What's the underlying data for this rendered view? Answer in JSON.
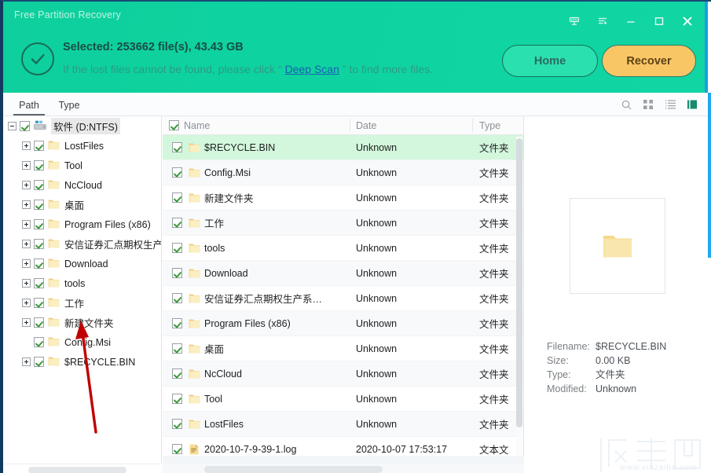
{
  "window": {
    "title": "Free Partition Recovery",
    "controls": [
      {
        "name": "cart-icon",
        "label": "Shop"
      },
      {
        "name": "feedback-icon",
        "label": "Feedback"
      },
      {
        "name": "minimize-icon",
        "label": "Minimize"
      },
      {
        "name": "maximize-icon",
        "label": "Maximize"
      },
      {
        "name": "close-icon",
        "label": "Close"
      }
    ]
  },
  "status": {
    "title": "Selected: 253662 file(s), 43.43 GB",
    "sub_before": "If the lost files cannot be found, please click “",
    "deep_scan_link": "Deep Scan",
    "sub_after": "” to find more files.",
    "check_icon": "check-circle-icon"
  },
  "actions": {
    "home_label": "Home",
    "recover_label": "Recover",
    "home_color": "#2ae0ae",
    "recover_color": "#f9c666"
  },
  "tabs": {
    "items": [
      {
        "label": "Path",
        "active": true
      },
      {
        "label": "Type",
        "active": false
      }
    ],
    "tools": [
      {
        "name": "search-icon",
        "active": false
      },
      {
        "name": "grid-view-icon",
        "active": false
      },
      {
        "name": "list-view-icon",
        "active": false
      },
      {
        "name": "preview-pane-icon",
        "active": true
      }
    ]
  },
  "tree": {
    "root": {
      "label": "软件 (D:NTFS)",
      "icon": "drive-icon",
      "checked": true,
      "expanded": true
    },
    "items": [
      {
        "label": "LostFiles",
        "checked": true,
        "expandable": true
      },
      {
        "label": "Tool",
        "checked": true,
        "expandable": true
      },
      {
        "label": "NcCloud",
        "checked": true,
        "expandable": true
      },
      {
        "label": "桌面",
        "checked": true,
        "expandable": true
      },
      {
        "label": "Program Files (x86)",
        "checked": true,
        "expandable": true
      },
      {
        "label": "安信证券汇点期权生产系",
        "checked": true,
        "expandable": true
      },
      {
        "label": "Download",
        "checked": true,
        "expandable": true
      },
      {
        "label": "tools",
        "checked": true,
        "expandable": true
      },
      {
        "label": "工作",
        "checked": true,
        "expandable": true
      },
      {
        "label": "新建文件夹",
        "checked": true,
        "expandable": true
      },
      {
        "label": "Config.Msi",
        "checked": true,
        "expandable": false
      },
      {
        "label": "$RECYCLE.BIN",
        "checked": true,
        "expandable": true
      }
    ]
  },
  "filelist": {
    "columns": {
      "name": "Name",
      "date": "Date",
      "type": "Type"
    },
    "header_checked": true,
    "rows": [
      {
        "name": "$RECYCLE.BIN",
        "date": "Unknown",
        "type": "文件夹",
        "icon": "folder-icon",
        "checked": true,
        "selected": true
      },
      {
        "name": "Config.Msi",
        "date": "Unknown",
        "type": "文件夹",
        "icon": "folder-icon",
        "checked": true,
        "selected": false
      },
      {
        "name": "新建文件夹",
        "date": "Unknown",
        "type": "文件夹",
        "icon": "folder-icon",
        "checked": true,
        "selected": false
      },
      {
        "name": "工作",
        "date": "Unknown",
        "type": "文件夹",
        "icon": "folder-icon",
        "checked": true,
        "selected": false
      },
      {
        "name": "tools",
        "date": "Unknown",
        "type": "文件夹",
        "icon": "folder-icon",
        "checked": true,
        "selected": false
      },
      {
        "name": "Download",
        "date": "Unknown",
        "type": "文件夹",
        "icon": "folder-icon",
        "checked": true,
        "selected": false
      },
      {
        "name": "安信证券汇点期权生产系…",
        "date": "Unknown",
        "type": "文件夹",
        "icon": "folder-icon",
        "checked": true,
        "selected": false
      },
      {
        "name": "Program Files (x86)",
        "date": "Unknown",
        "type": "文件夹",
        "icon": "folder-icon",
        "checked": true,
        "selected": false
      },
      {
        "name": "桌面",
        "date": "Unknown",
        "type": "文件夹",
        "icon": "folder-icon",
        "checked": true,
        "selected": false
      },
      {
        "name": "NcCloud",
        "date": "Unknown",
        "type": "文件夹",
        "icon": "folder-icon",
        "checked": true,
        "selected": false
      },
      {
        "name": "Tool",
        "date": "Unknown",
        "type": "文件夹",
        "icon": "folder-icon",
        "checked": true,
        "selected": false
      },
      {
        "name": "LostFiles",
        "date": "Unknown",
        "type": "文件夹",
        "icon": "folder-icon",
        "checked": true,
        "selected": false
      },
      {
        "name": "2020-10-7-9-39-1.log",
        "date": "2020-10-07 17:53:17",
        "type": "文本文",
        "icon": "log-file-icon",
        "checked": true,
        "selected": false
      }
    ]
  },
  "preview": {
    "thumb_icon": "folder-icon",
    "fields": [
      {
        "key": "Filename:",
        "value": "$RECYCLE.BIN"
      },
      {
        "key": "Size:",
        "value": "0.00 KB"
      },
      {
        "key": "Type:",
        "value": "文件夹"
      },
      {
        "key": "Modified:",
        "value": "Unknown"
      }
    ]
  },
  "watermark": {
    "site": "www.xiazaiba.com",
    "brand": "下载吧"
  }
}
